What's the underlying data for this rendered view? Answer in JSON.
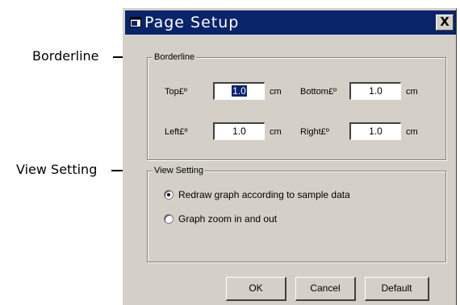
{
  "callouts": {
    "borderline": "Borderline",
    "view_setting": "View Setting"
  },
  "dialog": {
    "title": "Page Setup",
    "icon": "page-setup-icon",
    "close_label": "X",
    "title_bar_color": "#0a246a",
    "face_color": "#d4d0c8"
  },
  "borderline_group": {
    "legend": "Borderline",
    "top_label": "Top£º",
    "top_value": "1.0",
    "bottom_label": "Bottom£º",
    "bottom_value": "1.0",
    "left_label": "Left£º",
    "left_value": "1.0",
    "right_label": "Right£º",
    "right_value": "1.0",
    "unit": "cm"
  },
  "view_group": {
    "legend": "View Setting",
    "option_redraw": "Redraw graph according to sample data",
    "option_zoom": "Graph zoom in and out",
    "selected": "option_redraw"
  },
  "buttons": {
    "ok": "OK",
    "cancel": "Cancel",
    "default": "Default"
  }
}
